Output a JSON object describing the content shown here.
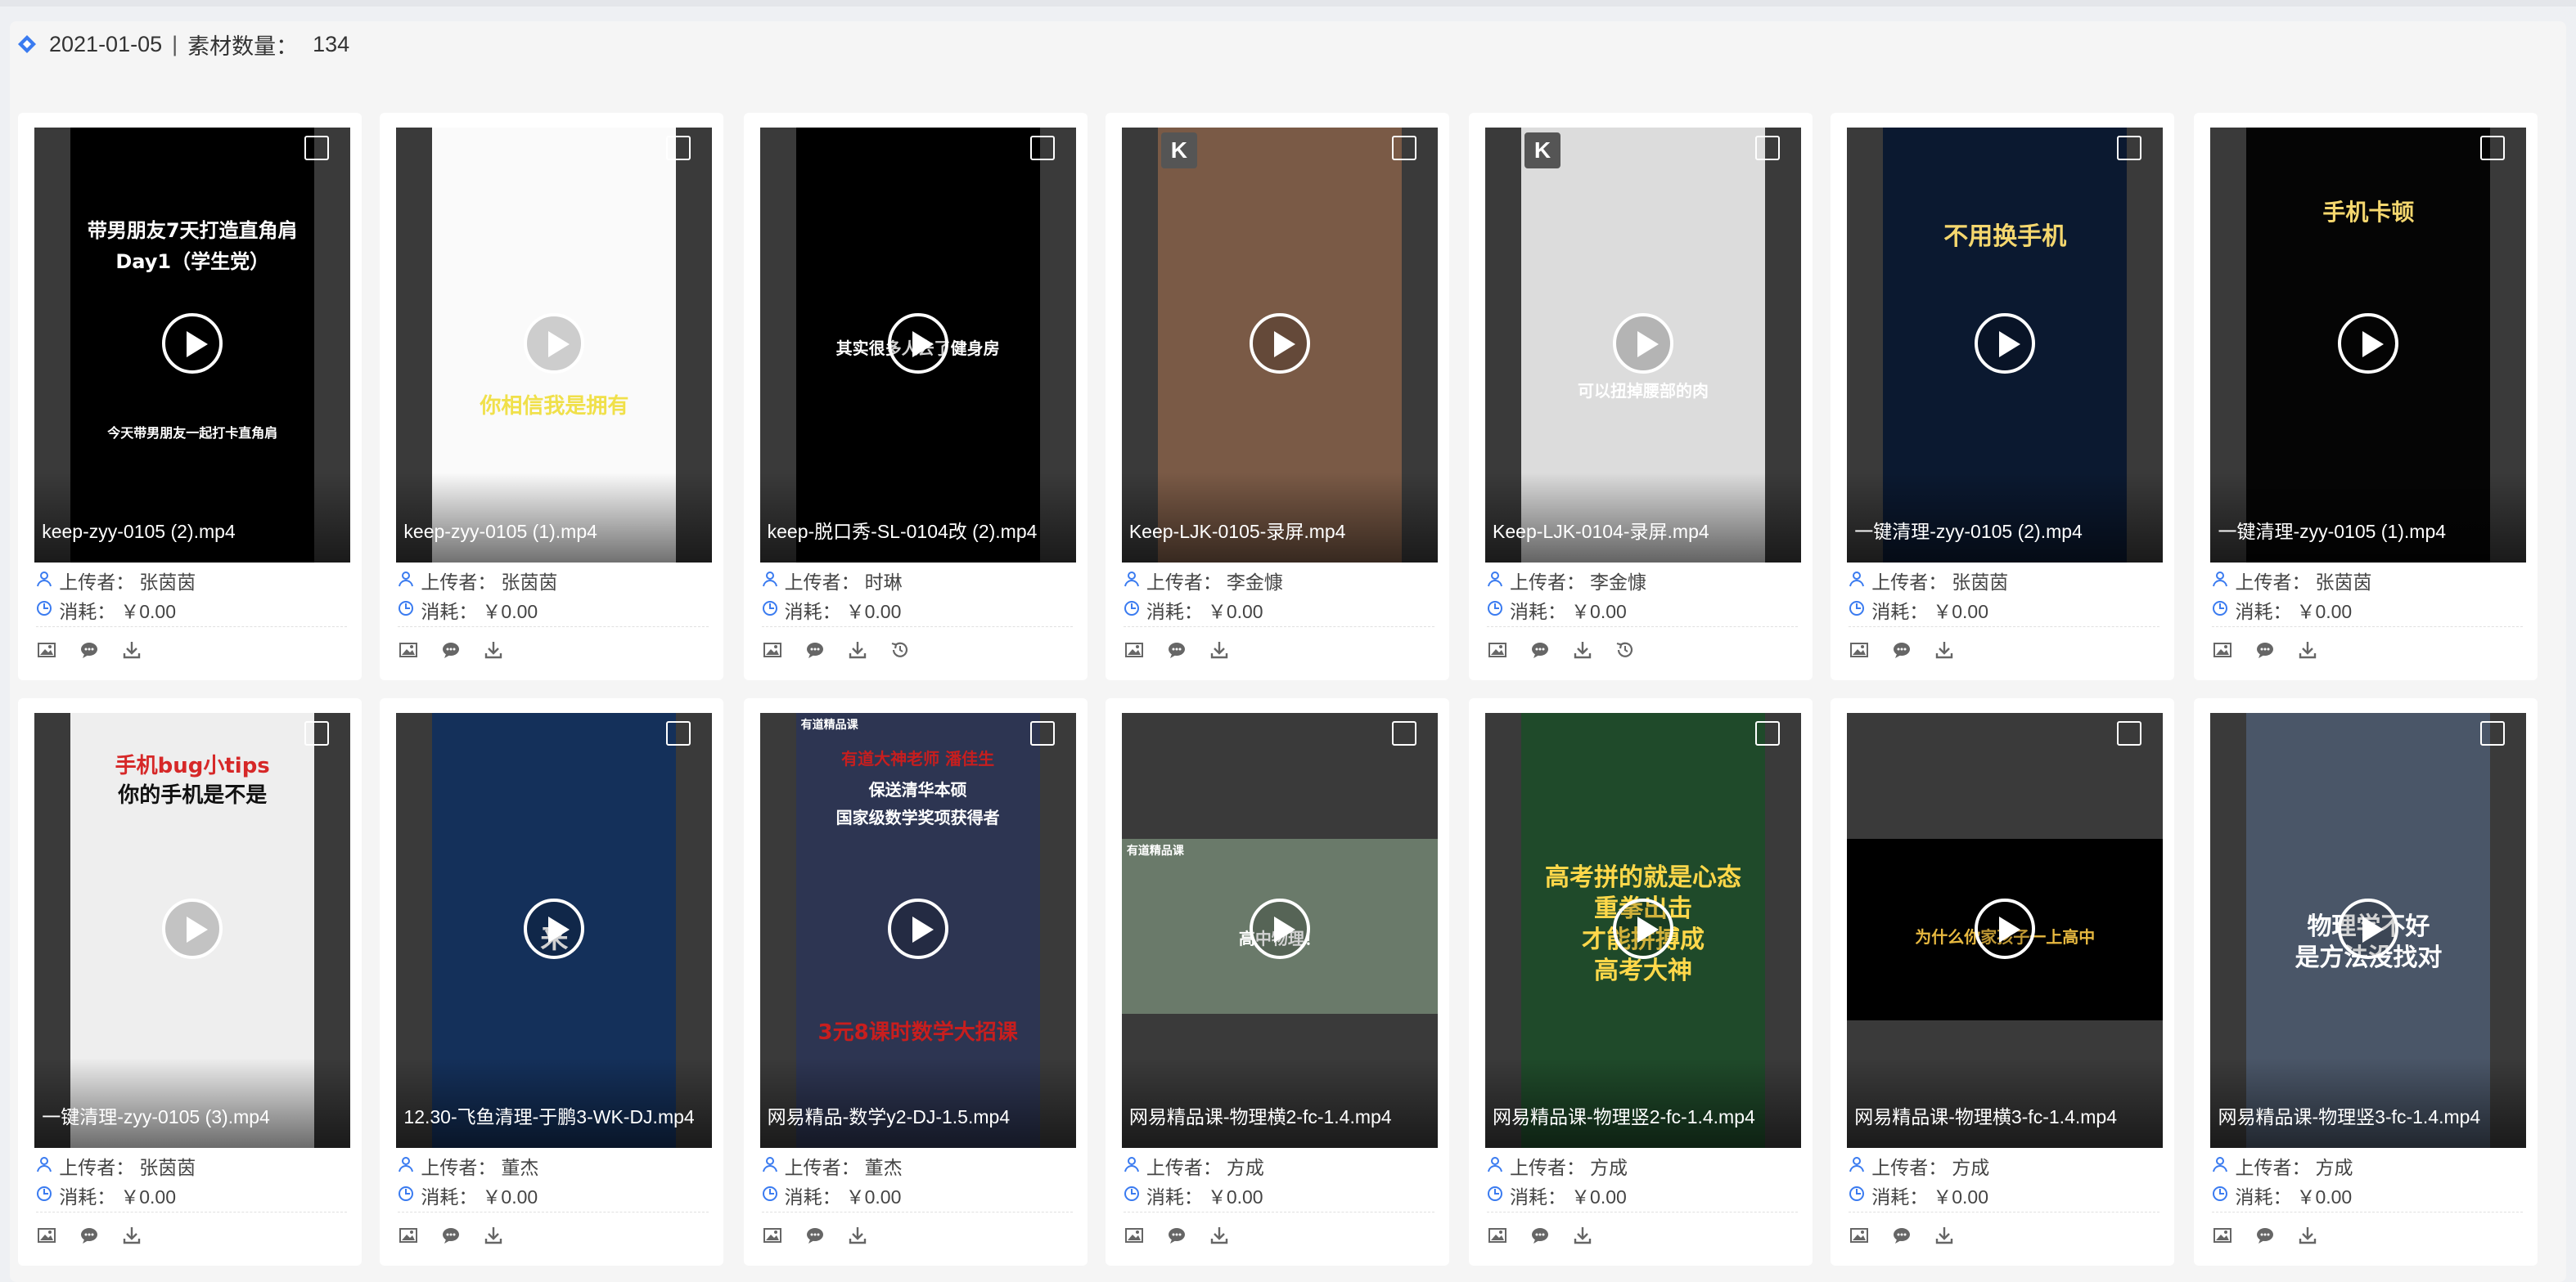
{
  "header": {
    "date": "2021-01-05",
    "separator": "|",
    "count_label": "素材数量：",
    "count_value": "134"
  },
  "labels": {
    "uploader": "上传者：",
    "cost": "消耗："
  },
  "colors": {
    "accent": "#3a7bf0",
    "icon_gray": "#666666"
  },
  "cards": [
    {
      "file": "keep-zyy-0105 (2).mp4",
      "uploader": "张茵茵",
      "cost": "￥0.00",
      "poster_lines": [
        "带男朋友7天打造直角肩",
        "Day1（学生党）"
      ],
      "sub": "今天带男朋友一起打卡直角肩",
      "has_history": false
    },
    {
      "file": "keep-zyy-0105 (1).mp4",
      "uploader": "张茵茵",
      "cost": "￥0.00",
      "poster_lines": [
        "你相信我是拥有"
      ],
      "sub": "",
      "has_history": false
    },
    {
      "file": "keep-脱口秀-SL-0104改 (2).mp4",
      "uploader": "时琳",
      "cost": "￥0.00",
      "poster_lines": [
        "其实很多人去了健身房"
      ],
      "sub": "",
      "has_history": true
    },
    {
      "file": "Keep-LJK-0105-录屏.mp4",
      "uploader": "李金慷",
      "cost": "￥0.00",
      "poster_lines": [],
      "sub": "",
      "has_history": false
    },
    {
      "file": "Keep-LJK-0104-录屏.mp4",
      "uploader": "李金慷",
      "cost": "￥0.00",
      "poster_lines": [
        "可以扭掉腰部的肉"
      ],
      "sub": "",
      "has_history": true
    },
    {
      "file": "一键清理-zyy-0105 (2).mp4",
      "uploader": "张茵茵",
      "cost": "￥0.00",
      "poster_lines": [
        "不用换手机"
      ],
      "sub": "",
      "has_history": false
    },
    {
      "file": "一键清理-zyy-0105 (1).mp4",
      "uploader": "张茵茵",
      "cost": "￥0.00",
      "poster_lines": [
        "手机卡顿"
      ],
      "sub": "",
      "has_history": false
    },
    {
      "file": "一键清理-zyy-0105 (3).mp4",
      "uploader": "张茵茵",
      "cost": "￥0.00",
      "poster_lines": [
        "手机bug小tips",
        "你的手机是不是"
      ],
      "sub": "",
      "has_history": false
    },
    {
      "file": "12.30-飞鱼清理-于鹏3-WK-DJ.mp4",
      "uploader": "董杰",
      "cost": "￥0.00",
      "poster_lines": [
        "来"
      ],
      "sub": "",
      "has_history": false
    },
    {
      "file": "网易精品-数学y2-DJ-1.5.mp4",
      "uploader": "董杰",
      "cost": "￥0.00",
      "poster_lines": [
        "有道大神老师 潘佳生",
        "保送清华本硕",
        "国家级数学奖项获得者",
        "3元8课时数学大招课"
      ],
      "sub": "有道精品课",
      "has_history": false
    },
    {
      "file": "网易精品课-物理横2-fc-1.4.mp4",
      "uploader": "方成",
      "cost": "￥0.00",
      "poster_lines": [
        "高中物理！"
      ],
      "sub": "有道精品课",
      "has_history": false
    },
    {
      "file": "网易精品课-物理竖2-fc-1.4.mp4",
      "uploader": "方成",
      "cost": "￥0.00",
      "poster_lines": [
        "高考拼的就是心态",
        "重拳出击",
        "才能拼搏成",
        "高考大神"
      ],
      "sub": "",
      "has_history": false
    },
    {
      "file": "网易精品课-物理横3-fc-1.4.mp4",
      "uploader": "方成",
      "cost": "￥0.00",
      "poster_lines": [
        "为什么你家孩子一上高中"
      ],
      "sub": "",
      "has_history": false
    },
    {
      "file": "网易精品课-物理竖3-fc-1.4.mp4",
      "uploader": "方成",
      "cost": "￥0.00",
      "poster_lines": [
        "物理学不好",
        "是方法没找对"
      ],
      "sub": "",
      "has_history": false
    }
  ]
}
